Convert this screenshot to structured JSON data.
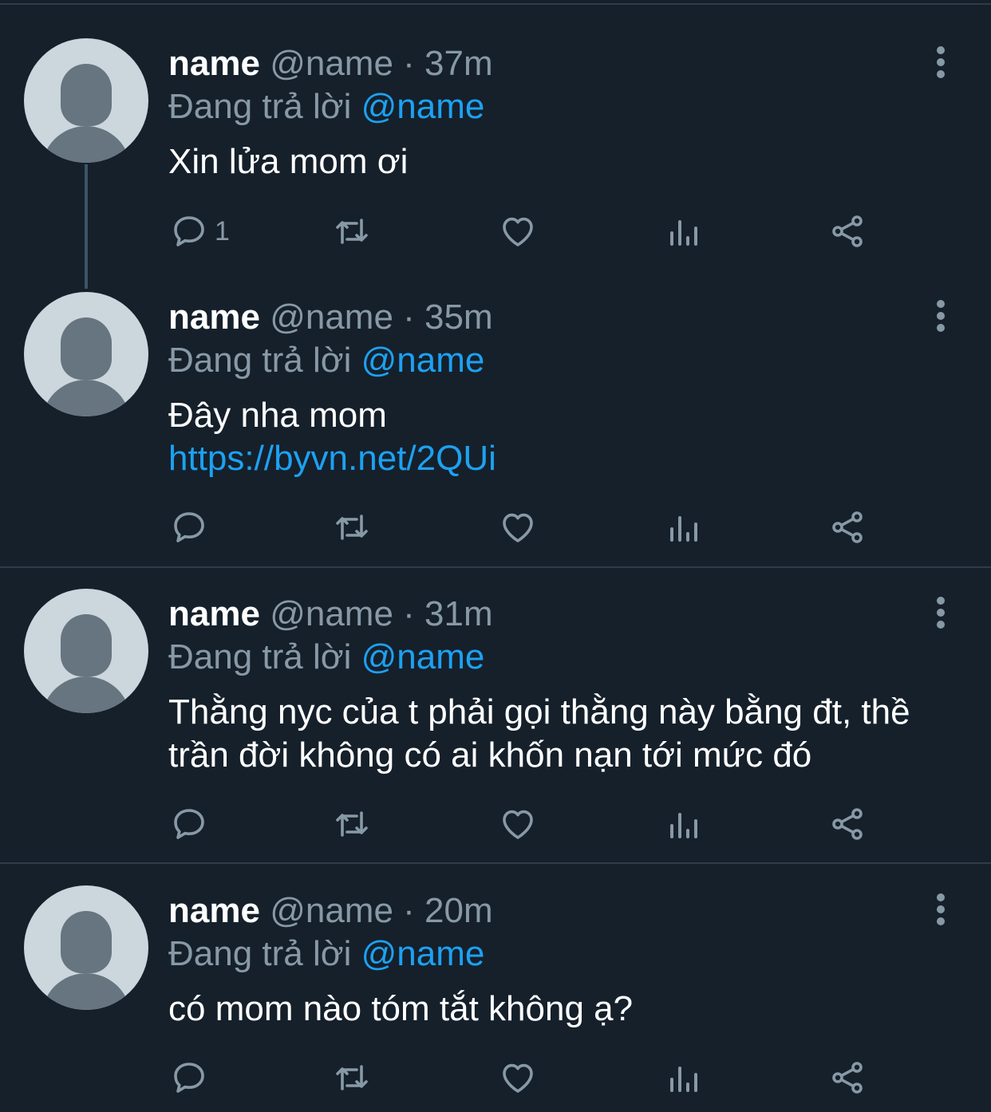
{
  "tweets": [
    {
      "display_name": "name",
      "handle": "@name",
      "separator": "·",
      "time": "37m",
      "reply_prefix": "Đang trả lời",
      "reply_mention": "@name",
      "text": "Xin lửa mom ơi",
      "link": "",
      "reply_count": "1"
    },
    {
      "display_name": "name",
      "handle": "@name",
      "separator": "·",
      "time": "35m",
      "reply_prefix": "Đang trả lời",
      "reply_mention": "@name",
      "text": "Đây nha mom",
      "link": "https://byvn.net/2QUi",
      "reply_count": ""
    },
    {
      "display_name": "name",
      "handle": "@name",
      "separator": "·",
      "time": "31m",
      "reply_prefix": "Đang trả lời",
      "reply_mention": "@name",
      "text": "Thằng nyc của t phải gọi thằng này bằng đt, thề trần đời không có ai khốn nạn tới mức đó",
      "link": "",
      "reply_count": ""
    },
    {
      "display_name": "name",
      "handle": "@name",
      "separator": "·",
      "time": "20m",
      "reply_prefix": "Đang trả lời",
      "reply_mention": "@name",
      "text": "có mom nào tóm tắt không ạ?",
      "link": "",
      "reply_count": ""
    }
  ],
  "icons": {
    "reply": "reply-icon",
    "retweet": "retweet-icon",
    "like": "heart-icon",
    "analytics": "analytics-icon",
    "share": "share-icon",
    "more": "more-vertical-icon"
  },
  "colors": {
    "background": "#15202b",
    "text_primary": "#ffffff",
    "text_secondary": "#8899a6",
    "accent": "#1da1f2",
    "divider": "#2f3b47"
  }
}
